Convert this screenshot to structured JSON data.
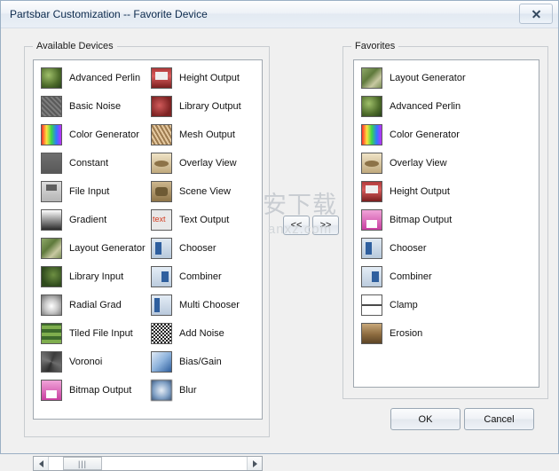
{
  "window": {
    "title": "Partsbar Customization -- Favorite Device",
    "close_icon": "close-icon"
  },
  "available": {
    "legend": "Available Devices",
    "column1": [
      {
        "label": "Advanced Perlin",
        "thumb": "advanced-perlin"
      },
      {
        "label": "Basic Noise",
        "thumb": "basic-noise"
      },
      {
        "label": "Color Generator",
        "thumb": "color-generator"
      },
      {
        "label": "Constant",
        "thumb": "constant"
      },
      {
        "label": "File Input",
        "thumb": "file-input"
      },
      {
        "label": "Gradient",
        "thumb": "gradient"
      },
      {
        "label": "Layout Generator",
        "thumb": "layout-generator"
      },
      {
        "label": "Library Input",
        "thumb": "library-input"
      },
      {
        "label": "Radial Grad",
        "thumb": "radial-grad"
      },
      {
        "label": "Tiled File Input",
        "thumb": "tiled-file-input"
      },
      {
        "label": "Voronoi",
        "thumb": "voronoi"
      },
      {
        "label": "Bitmap Output",
        "thumb": "bitmap-output"
      }
    ],
    "column2": [
      {
        "label": "Height Output",
        "thumb": "height-output"
      },
      {
        "label": "Library Output",
        "thumb": "library-output"
      },
      {
        "label": "Mesh Output",
        "thumb": "mesh-output"
      },
      {
        "label": "Overlay View",
        "thumb": "overlay-view"
      },
      {
        "label": "Scene View",
        "thumb": "scene-view"
      },
      {
        "label": "Text Output",
        "thumb": "text-output"
      },
      {
        "label": "Chooser",
        "thumb": "chooser"
      },
      {
        "label": "Combiner",
        "thumb": "combiner"
      },
      {
        "label": "Multi Chooser",
        "thumb": "multi-chooser"
      },
      {
        "label": "Add Noise",
        "thumb": "add-noise"
      },
      {
        "label": "Bias/Gain",
        "thumb": "bias-gain"
      },
      {
        "label": "Blur",
        "thumb": "blur"
      }
    ],
    "scrollbar": {
      "left_arrow": "◀",
      "right_arrow": "▶",
      "grip": "|||"
    }
  },
  "favorites": {
    "legend": "Favorites",
    "items": [
      {
        "label": "Layout Generator",
        "thumb": "layout-generator"
      },
      {
        "label": "Advanced Perlin",
        "thumb": "advanced-perlin"
      },
      {
        "label": "Color Generator",
        "thumb": "color-generator"
      },
      {
        "label": "Overlay View",
        "thumb": "overlay-view"
      },
      {
        "label": "Height Output",
        "thumb": "height-output"
      },
      {
        "label": "Bitmap Output",
        "thumb": "bitmap-output"
      },
      {
        "label": "Chooser",
        "thumb": "chooser"
      },
      {
        "label": "Combiner",
        "thumb": "combiner"
      },
      {
        "label": "Clamp",
        "thumb": "clamp"
      },
      {
        "label": "Erosion",
        "thumb": "erosion"
      }
    ]
  },
  "transfer": {
    "add_label": "<<",
    "remove_label": ">>"
  },
  "buttons": {
    "ok": "OK",
    "cancel": "Cancel"
  },
  "watermark": {
    "logo": "安下载",
    "url": "anxz.com"
  }
}
